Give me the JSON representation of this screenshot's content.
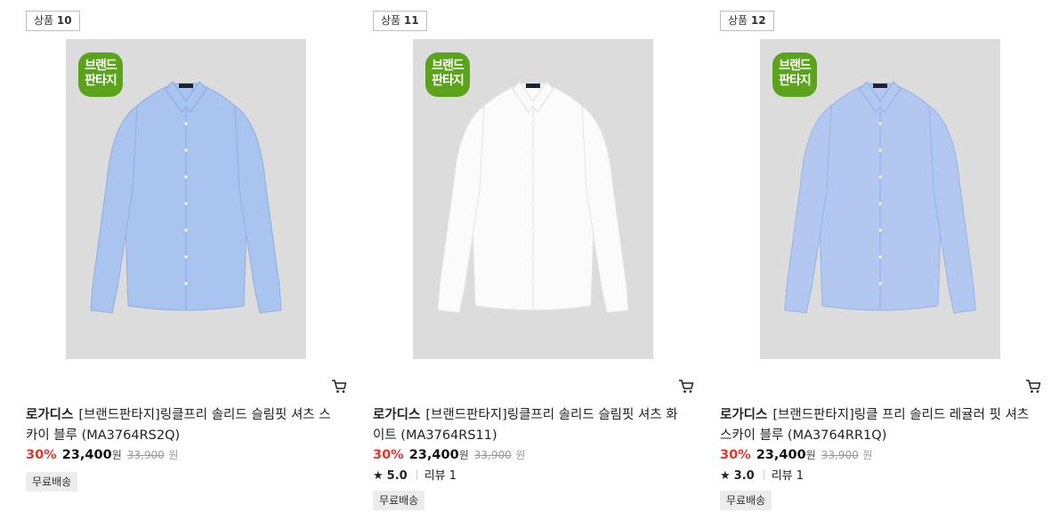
{
  "products": [
    {
      "rank_label": "상품",
      "rank_number": "10",
      "brand_badge_line1": "브랜드",
      "brand_badge_line2": "판타지",
      "shirt_color": "#a9c4ee",
      "shirt_shade": "#8eaee2",
      "brand": "로가디스",
      "title": "[브랜드판타지]링클프리 솔리드 슬림핏 셔츠 스카이 블루 (MA3764RS2Q)",
      "discount": "30%",
      "price": "23,400",
      "price_unit": "원",
      "original_price": "33,900",
      "original_unit": "원",
      "rating": "",
      "review_label": "",
      "shipping": "무료배송"
    },
    {
      "rank_label": "상품",
      "rank_number": "11",
      "brand_badge_line1": "브랜드",
      "brand_badge_line2": "판타지",
      "shirt_color": "#fbfbfb",
      "shirt_shade": "#e4e4e4",
      "brand": "로가디스",
      "title": "[브랜드판타지]링클프리 솔리드 슬림핏 셔츠 화이트 (MA3764RS11)",
      "discount": "30%",
      "price": "23,400",
      "price_unit": "원",
      "original_price": "33,900",
      "original_unit": "원",
      "star_icon": "★",
      "rating": "5.0",
      "review_label": "리뷰 1",
      "shipping": "무료배송"
    },
    {
      "rank_label": "상품",
      "rank_number": "12",
      "brand_badge_line1": "브랜드",
      "brand_badge_line2": "판타지",
      "shirt_color": "#b3c8f0",
      "shirt_shade": "#97b2e6",
      "brand": "로가디스",
      "title": "[브랜드판타지]링클 프리 솔리드 레귤러 핏 셔츠 스카이 블루 (MA3764RR1Q)",
      "discount": "30%",
      "price": "23,400",
      "price_unit": "원",
      "original_price": "33,900",
      "original_unit": "원",
      "star_icon": "★",
      "rating": "3.0",
      "review_label": "리뷰 1",
      "shipping": "무료배송"
    }
  ],
  "icons": {
    "cart": "cart-icon",
    "star": "star-icon"
  }
}
